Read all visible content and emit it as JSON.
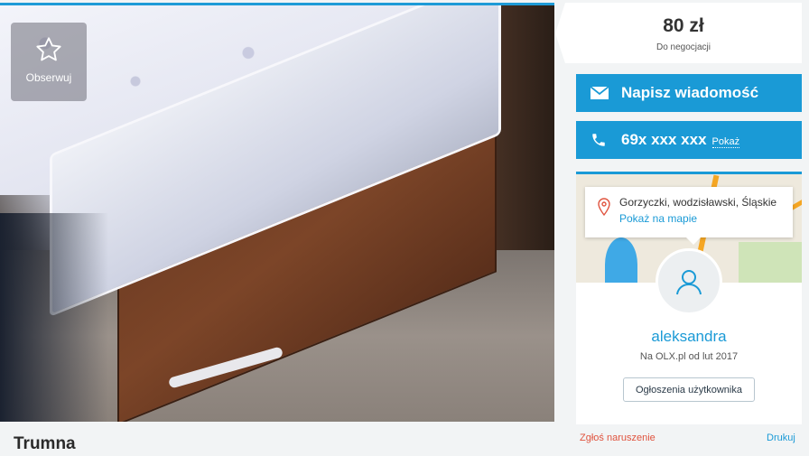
{
  "listing": {
    "title": "Trumna",
    "observe_label": "Obserwuj",
    "photo_alt": "zdjęcie ogłoszenia"
  },
  "price": {
    "amount": "80 zł",
    "note": "Do negocjacji"
  },
  "contact": {
    "message_label": "Napisz wiadomość",
    "phone_masked": "69x xxx xxx",
    "phone_show": "Pokaż"
  },
  "seller": {
    "location": "Gorzyczki, wodzisławski, Śląskie",
    "map_link": "Pokaż na mapie",
    "name": "aleksandra",
    "member_since": "Na OLX.pl od lut 2017",
    "user_ads_label": "Ogłoszenia użytkownika"
  },
  "footer": {
    "report_label": "Zgłoś naruszenie",
    "print_label": "Drukuj"
  },
  "colors": {
    "accent": "#1a9ad6",
    "report": "#e0533e"
  },
  "icons": {
    "observe": "star-icon",
    "message": "envelope-icon",
    "phone": "phone-icon",
    "location": "map-pin-icon",
    "avatar": "user-icon"
  }
}
